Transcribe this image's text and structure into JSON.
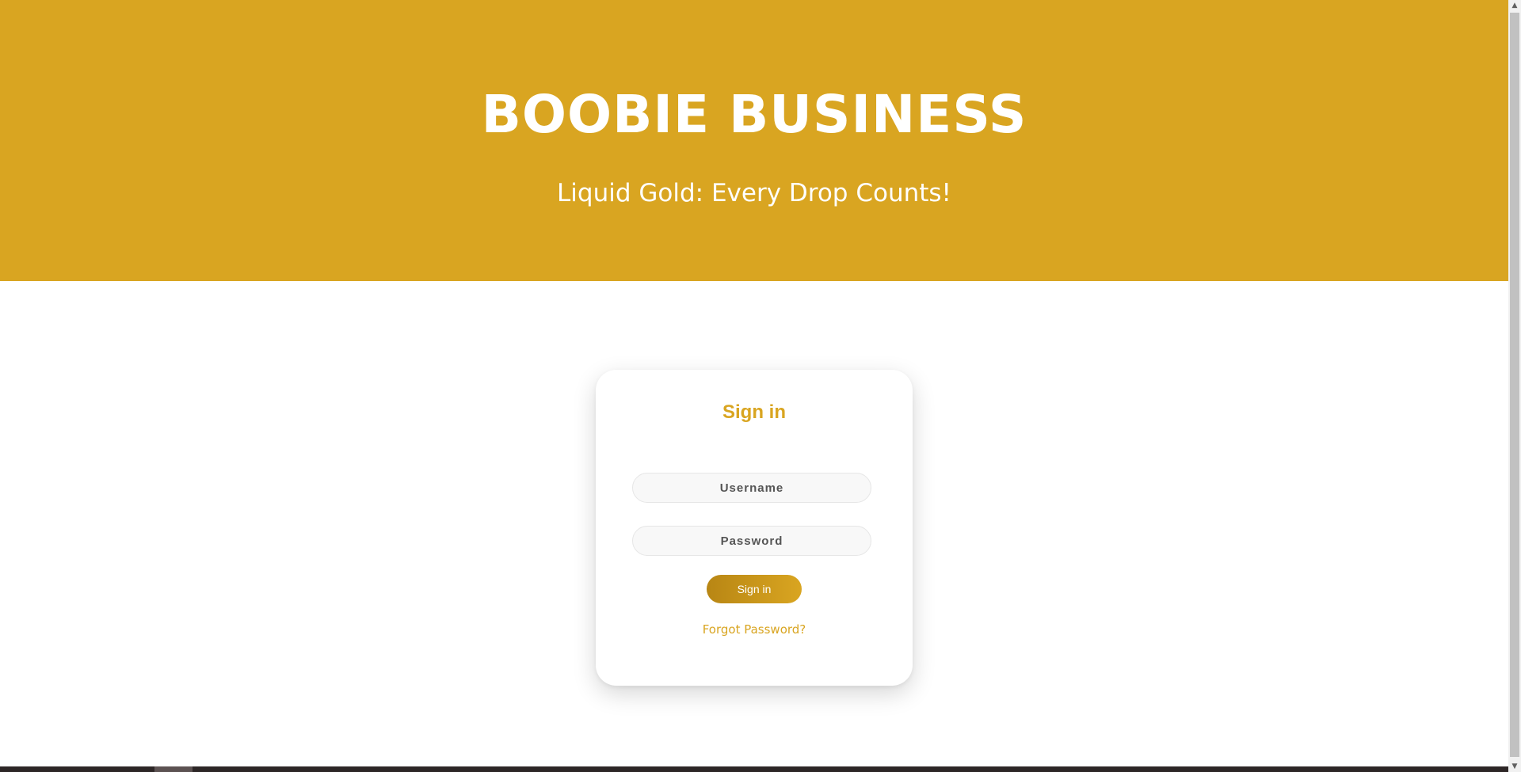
{
  "header": {
    "title": "BOOBIE BUSINESS",
    "tagline": "Liquid Gold: Every Drop Counts!"
  },
  "login": {
    "heading": "Sign in",
    "username_placeholder": "Username",
    "password_placeholder": "Password",
    "submit_label": "Sign in",
    "forgot_label": "Forgot Password?"
  },
  "colors": {
    "brand_gold": "#d9a521",
    "button_gradient_start": "#b88614",
    "text_on_brand": "#ffffff"
  },
  "scrollbar": {
    "up_icon": "triangle-up",
    "down_icon": "triangle-down"
  }
}
